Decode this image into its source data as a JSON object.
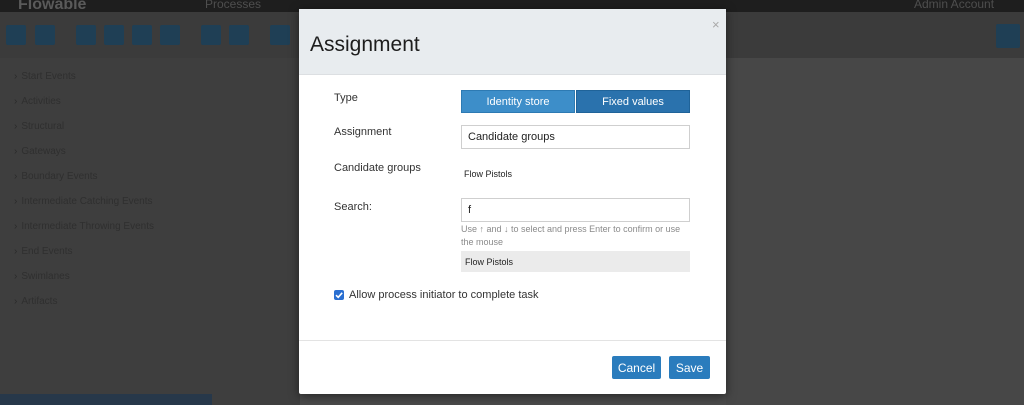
{
  "app": {
    "brand": "Flowable",
    "nav_label": "Processes",
    "user_label": "Admin Account",
    "palette_items": [
      "Start Events",
      "Activities",
      "Structural",
      "Gateways",
      "Boundary Events",
      "Intermediate Catching Events",
      "Intermediate Throwing Events",
      "End Events",
      "Swimlanes",
      "Artifacts"
    ]
  },
  "modal": {
    "title": "Assignment",
    "close_symbol": "×",
    "type_label": "Type",
    "type_options": [
      "Identity store",
      "Fixed values"
    ],
    "assignment_label": "Assignment",
    "assignment_value": "Candidate groups",
    "candidate_groups_label": "Candidate groups",
    "candidate_groups_value": "Flow Pistols",
    "search_label": "Search:",
    "search_value": "f",
    "search_hint": "Use ↑ and ↓ to select and press Enter to confirm or use the mouse",
    "search_result": "Flow Pistols",
    "checkbox_label": "Allow process initiator to complete task",
    "checkbox_checked": true,
    "cancel_label": "Cancel",
    "save_label": "Save"
  },
  "colors": {
    "primary": "#2a7cbd",
    "header_bg": "#e8ecef",
    "overlay_bg": "#4a4a4a"
  }
}
